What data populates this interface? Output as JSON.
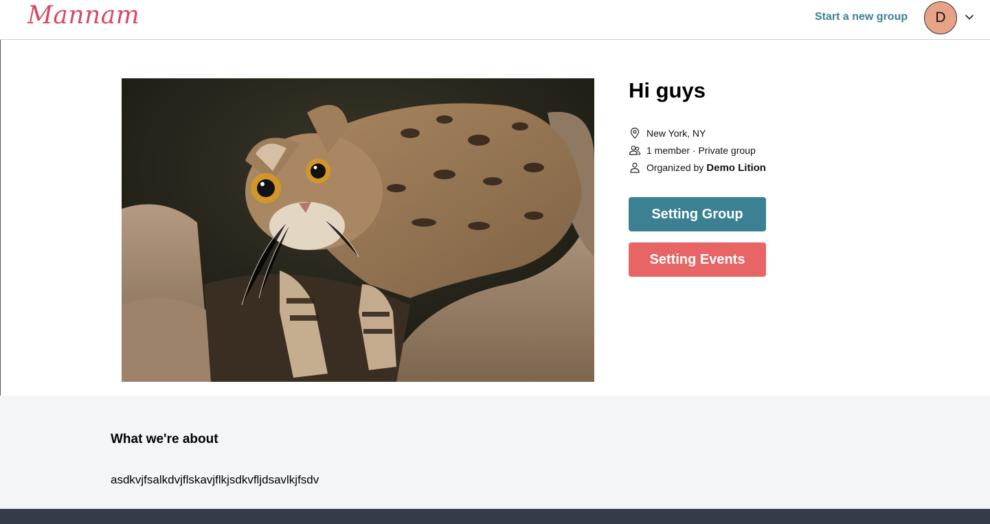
{
  "header": {
    "logo": "Mannam",
    "start_group_link": "Start a new group",
    "avatar_initial": "D"
  },
  "group": {
    "title": "Hi guys",
    "location": "New York, NY",
    "members": "1 member · Private group",
    "organized_by_label": "Organized by",
    "organizer_name": "Demo Lition"
  },
  "buttons": {
    "setting_group": "Setting Group",
    "setting_events": "Setting Events"
  },
  "about": {
    "title": "What we're about",
    "body": "asdkvjfsalkdvjflskavjflkjsdkvfljdsavlkjfsdv"
  },
  "colors": {
    "brand": "#d54b63",
    "teal": "#3b8193",
    "coral": "#e76565",
    "footer": "#353b48"
  }
}
